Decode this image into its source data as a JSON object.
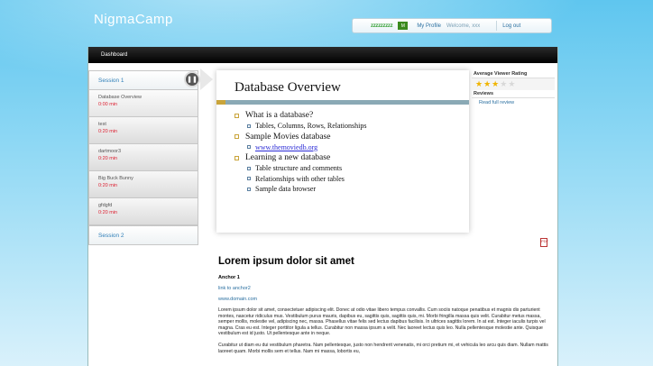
{
  "header": {
    "brand": "NigmaCamp",
    "user_handle": "zzzzzzzzz",
    "flag_label": "M",
    "profile_label": "My Profile",
    "welcome_text": "Welcome, xxx",
    "logout_label": "Log out"
  },
  "nav": {
    "dashboard_label": "Dashboard"
  },
  "sidebar": {
    "session1_label": "Session 1",
    "session2_label": "Session 2",
    "lessons": [
      {
        "name": "Database Overview",
        "time": "0:00 min",
        "active": true
      },
      {
        "name": "test",
        "time": "0:20 min"
      },
      {
        "name": "dartmoor3",
        "time": "0:20 min"
      },
      {
        "name": "Big Buck Bunny",
        "time": "0:20 min"
      },
      {
        "name": "gfdgfd",
        "time": "0:20 min"
      }
    ],
    "pause_glyph": "❚❚"
  },
  "slide": {
    "title": "Database Overview",
    "bullets": [
      {
        "level": 1,
        "text": "What is a database?"
      },
      {
        "level": 2,
        "text": "Tables, Columns, Rows, Relationships"
      },
      {
        "level": 1,
        "text": "Sample Movies database"
      },
      {
        "level": 2,
        "text": "www.themoviedb.org",
        "link": true
      },
      {
        "level": 1,
        "text": "Learning a new database"
      },
      {
        "level": 2,
        "text": "Table structure and comments"
      },
      {
        "level": 2,
        "text": "Relationships with other tables"
      },
      {
        "level": 2,
        "text": "Sample data browser"
      }
    ]
  },
  "ratings": {
    "heading": "Average Viewer Rating",
    "value": 3,
    "max": 5,
    "reviews_heading": "Reviews",
    "read_all": "Read full review"
  },
  "pdf_icon_label": "PDF",
  "content": {
    "heading": "Lorem ipsum dolor sit amet",
    "anchor_label": "Anchor 1",
    "link1": "link to anchor2",
    "link2": "www.domain.com",
    "para1": "Lorem ipsum dolor sit amet, consectetuer adipiscing elit. Donec at odio vitae libero tempus convallis. Cum sociis natoque penatibus et magnis dis parturient montes, nascetur ridiculus mus. Vestibulum purus mauris, dapibus eu, sagittis quis, sagittis quis, mi. Morbi fringilla massa quis velit. Curabitur metus massa, semper mollis, molestie vel, adipiscing nec, massa. Phasellus vitae felis sed lectus dapibus facilisis. In ultrices sagittis lorem. In at est. Integer iaculis turpis vel magna. Cras eu est. Integer porttitor ligula a tellus. Curabitur non massa ipsum a velit. Nec laoreet lectus quis leo. Nulla pellentesque molestie ante. Quisque vestibulum est id justo. Ut pellentesque ante in neque.",
    "para2": "Curabitur ut diam eu dui vestibulum pharetra. Nam pellentesque, justo non hendrerit venenatis, mi orci pretium mi, et vehicula leo arcu quis diam. Nullam mattis laoreet quam. Morbi mollis sem et tellus. Nam mi massa, lobortis eu,"
  }
}
